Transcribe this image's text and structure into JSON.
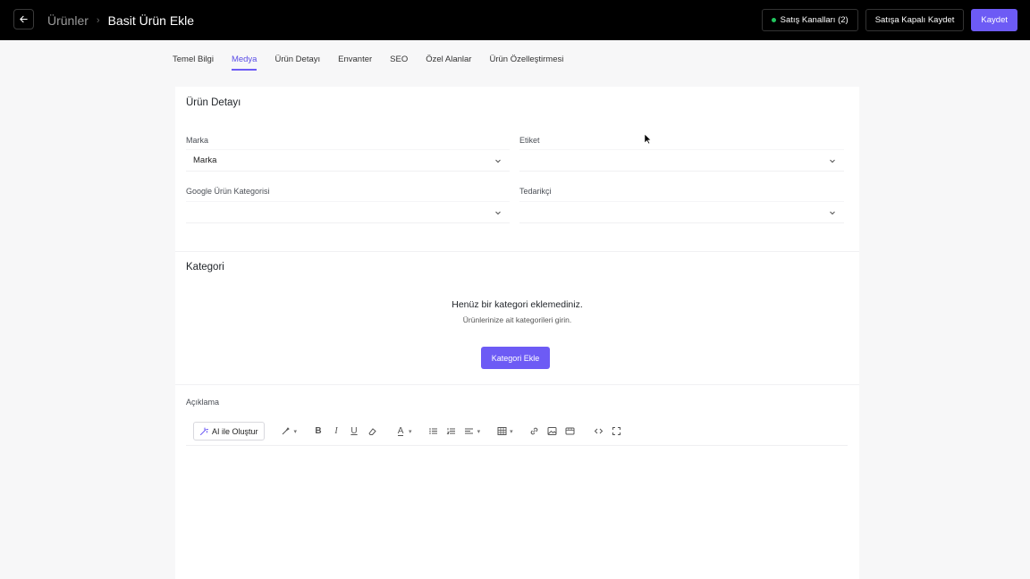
{
  "header": {
    "back_icon": "arrow-left-icon",
    "breadcrumb_parent": "Ürünler",
    "breadcrumb_current": "Basit Ürün Ekle",
    "channels_label": "Satış Kanalları (2)",
    "save_closed_label": "Satışa Kapalı Kaydet",
    "save_label": "Kaydet"
  },
  "tabs": [
    "Temel Bilgi",
    "Medya",
    "Ürün Detayı",
    "Envanter",
    "SEO",
    "Özel Alanlar",
    "Ürün Özelleştirmesi"
  ],
  "active_tab": "Medya",
  "detail": {
    "title": "Ürün Detayı",
    "brand_label": "Marka",
    "brand_value": "Marka",
    "tag_label": "Etiket",
    "google_label": "Google Ürün Kategorisi",
    "supplier_label": "Tedarikçi"
  },
  "category": {
    "title": "Kategori",
    "empty_title": "Henüz bir kategori eklemediniz.",
    "empty_sub": "Ürünlerinize ait kategorileri girin.",
    "add_label": "Kategori Ekle"
  },
  "description": {
    "label": "Açıklama",
    "ai_label": "AI ile Oluştur"
  },
  "colors": {
    "accent": "#6d5bf5",
    "header_bg": "#000000",
    "status_dot": "#22c55e"
  }
}
